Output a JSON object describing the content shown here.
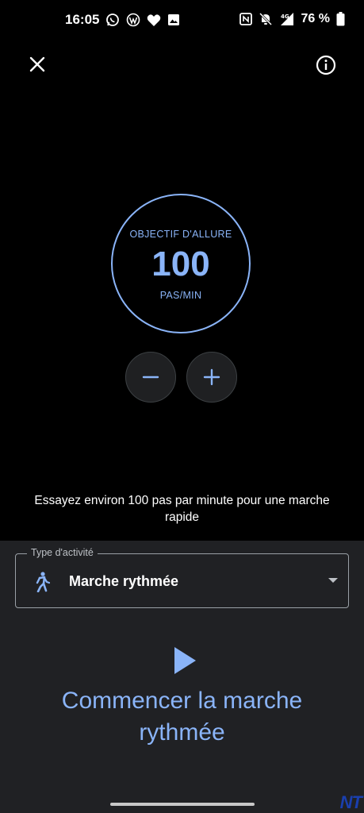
{
  "status_bar": {
    "time": "16:05",
    "left_icons": [
      "whatsapp-icon",
      "wordpress-icon",
      "heart-icon",
      "image-icon"
    ],
    "right_icons": [
      "nfc-icon",
      "silent-bell-icon",
      "signal-4g-icon",
      "battery-icon"
    ],
    "network": "4G",
    "battery": "76 %"
  },
  "header": {
    "close_icon": "close-icon",
    "info_icon": "info-icon"
  },
  "pace": {
    "label": "OBJECTIF D'ALLURE",
    "value": "100",
    "unit": "PAS/MIN"
  },
  "controls": {
    "decrease_icon": "minus-icon",
    "increase_icon": "plus-icon"
  },
  "hint": "Essayez environ 100 pas par minute pour une marche rapide",
  "activity": {
    "legend": "Type d'activité",
    "value": "Marche rythmée",
    "icon": "walking-icon"
  },
  "start": {
    "label": "Commencer la marche rythmée",
    "icon": "play-icon"
  },
  "watermark": "NT",
  "colors": {
    "accent": "#8ab4f8",
    "background": "#000000",
    "panel": "#202124"
  }
}
